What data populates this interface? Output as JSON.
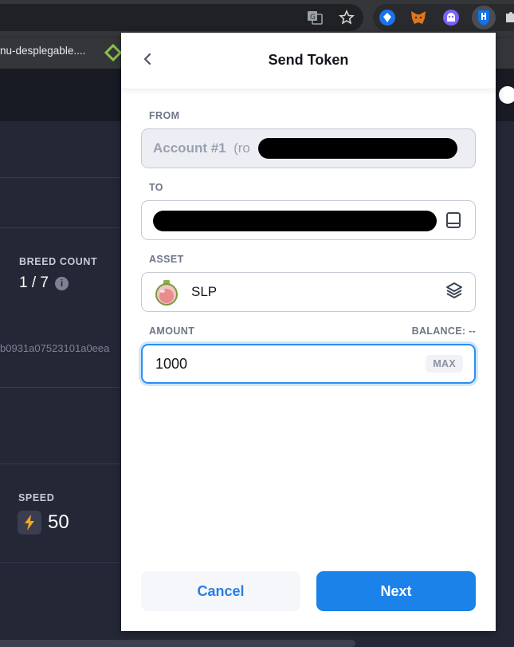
{
  "browser": {
    "bookmark_label": "nu-desplegable....",
    "icons": [
      "translate-icon",
      "star-icon",
      "extension-icon",
      "metamask-fox-icon",
      "ghost-icon",
      "ronin-wallet-icon",
      "puzzle-icon"
    ]
  },
  "background_page": {
    "breed_count_label": "BREED COUNT",
    "breed_count_value": "1 / 7",
    "info_glyph": "i",
    "hash_text": "b0931a07523101a0eea",
    "speed_label": "SPEED",
    "speed_value": "50"
  },
  "popup": {
    "title": "Send Token",
    "from": {
      "label": "FROM",
      "account_name": "Account #1",
      "account_suffix": "(ro"
    },
    "to": {
      "label": "TO",
      "value": ""
    },
    "asset": {
      "label": "ASSET",
      "symbol": "SLP"
    },
    "amount": {
      "label": "AMOUNT",
      "balance_text": "BALANCE: --",
      "value": "1000",
      "max_label": "MAX"
    },
    "cancel_label": "Cancel",
    "next_label": "Next"
  },
  "colors": {
    "accent": "#1a82e8",
    "focus_border": "#2b8ff0",
    "page_bg": "#242735"
  }
}
